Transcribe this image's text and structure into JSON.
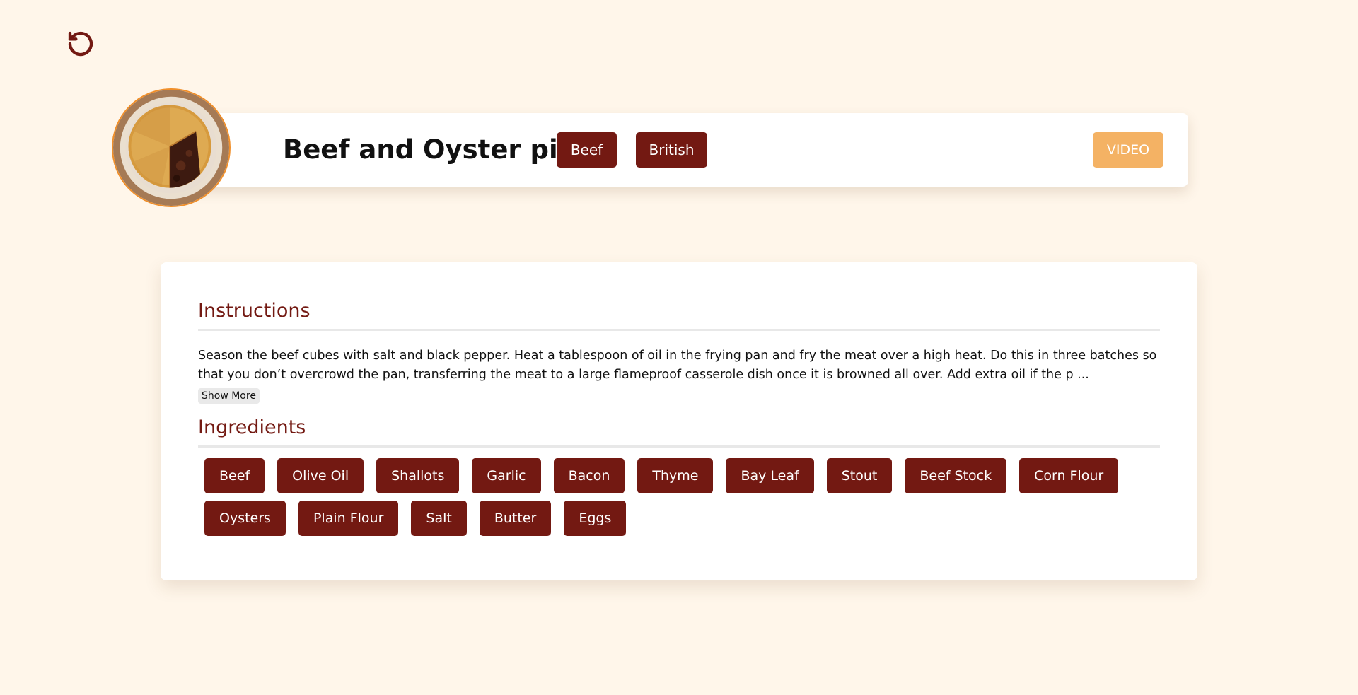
{
  "header": {
    "back_icon": "rotate-ccw-icon",
    "title": "Beef and Oyster pie",
    "category": "Beef",
    "area": "British",
    "video_label": "VIDEO"
  },
  "colors": {
    "background": "#fff6ea",
    "accent": "#731912",
    "video": "#f4b264",
    "image_border": "#f08f2a"
  },
  "instructions": {
    "title": "Instructions",
    "text": "Season the beef cubes with salt and black pepper. Heat a tablespoon of oil in the frying pan and fry the meat over a high heat. Do this in three batches so that you don’t overcrowd the pan, transferring the meat to a large flameproof casserole dish once it is browned all over. Add extra oil if the p ...",
    "show_more_label": "Show More"
  },
  "ingredients": {
    "title": "Ingredients",
    "items": [
      "Beef",
      "Olive Oil",
      "Shallots",
      "Garlic",
      "Bacon",
      "Thyme",
      "Bay Leaf",
      "Stout",
      "Beef Stock",
      "Corn Flour",
      "Oysters",
      "Plain Flour",
      "Salt",
      "Butter",
      "Eggs"
    ]
  }
}
